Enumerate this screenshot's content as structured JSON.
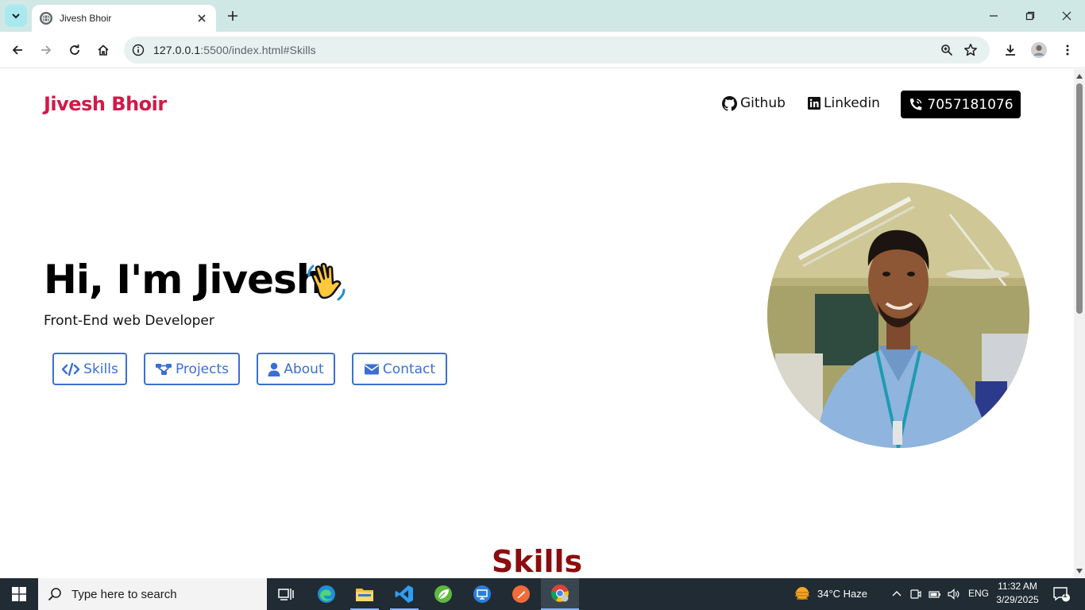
{
  "browser": {
    "tab_title": "Jivesh Bhoir",
    "url_host": "127.0.0.1",
    "url_rest": ":5500/index.html#Skills"
  },
  "site": {
    "brand": "Jivesh Bhoir",
    "nav": {
      "github": "Github",
      "linkedin": "Linkedin",
      "phone": "7057181076"
    },
    "hero": {
      "title": "Hi, I'm Jivesh",
      "subtitle": "Front-End web Developer",
      "buttons": {
        "skills": "Skills",
        "projects": "Projects",
        "about": "About",
        "contact": "Contact"
      }
    },
    "section_title": "Skills"
  },
  "taskbar": {
    "search_placeholder": "Type here to search",
    "weather": "34°C  Haze",
    "language": "ENG",
    "time": "11:32 AM",
    "date": "3/29/2025",
    "notification_count": "1"
  },
  "colors": {
    "brand": "#d01a47",
    "button_accent": "#3b6fd4",
    "section_title": "#8b0d0d"
  }
}
